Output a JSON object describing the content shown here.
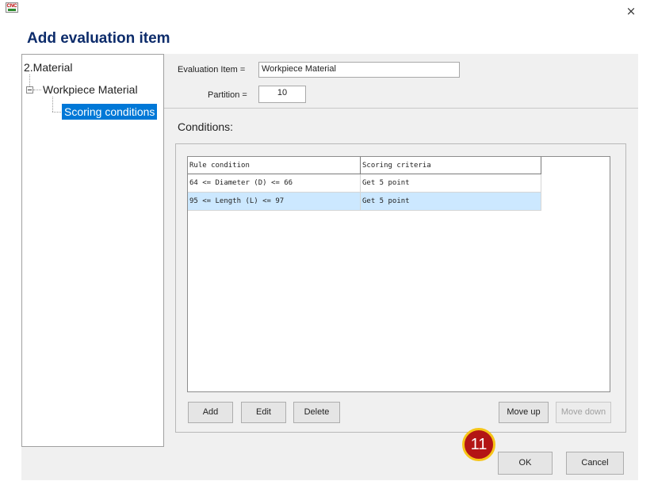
{
  "window": {
    "close_glyph": "×"
  },
  "dialog": {
    "title": "Add evaluation item"
  },
  "tree": {
    "root": "2.Material",
    "child": "Workpiece Material",
    "selected": "Scoring conditions"
  },
  "form": {
    "evaluation_item_label": "Evaluation Item =",
    "evaluation_item_value": "Workpiece Material",
    "partition_label": "Partition =",
    "partition_value": "10"
  },
  "conditions": {
    "label": "Conditions:",
    "columns": [
      "Rule condition",
      "Scoring criteria"
    ],
    "rows": [
      [
        "64 <= Diameter (D) <= 66",
        "Get 5 point"
      ],
      [
        "95 <= Length (L) <= 97",
        "Get 5 point"
      ]
    ],
    "selected_row": 1
  },
  "buttons": {
    "add": "Add",
    "edit": "Edit",
    "delete": "Delete",
    "move_up": "Move up",
    "move_down": "Move down",
    "ok": "OK",
    "cancel": "Cancel"
  },
  "callout": {
    "number": "11",
    "color": "#b31515",
    "ring_color": "#f6c518"
  },
  "colors": {
    "title": "#0d2c6b",
    "selection": "#0078d7",
    "row_selection": "#cce8ff"
  },
  "icons": {
    "app": "cnc-app-icon",
    "close": "close-icon",
    "tree_expander": "minus-box-icon"
  }
}
